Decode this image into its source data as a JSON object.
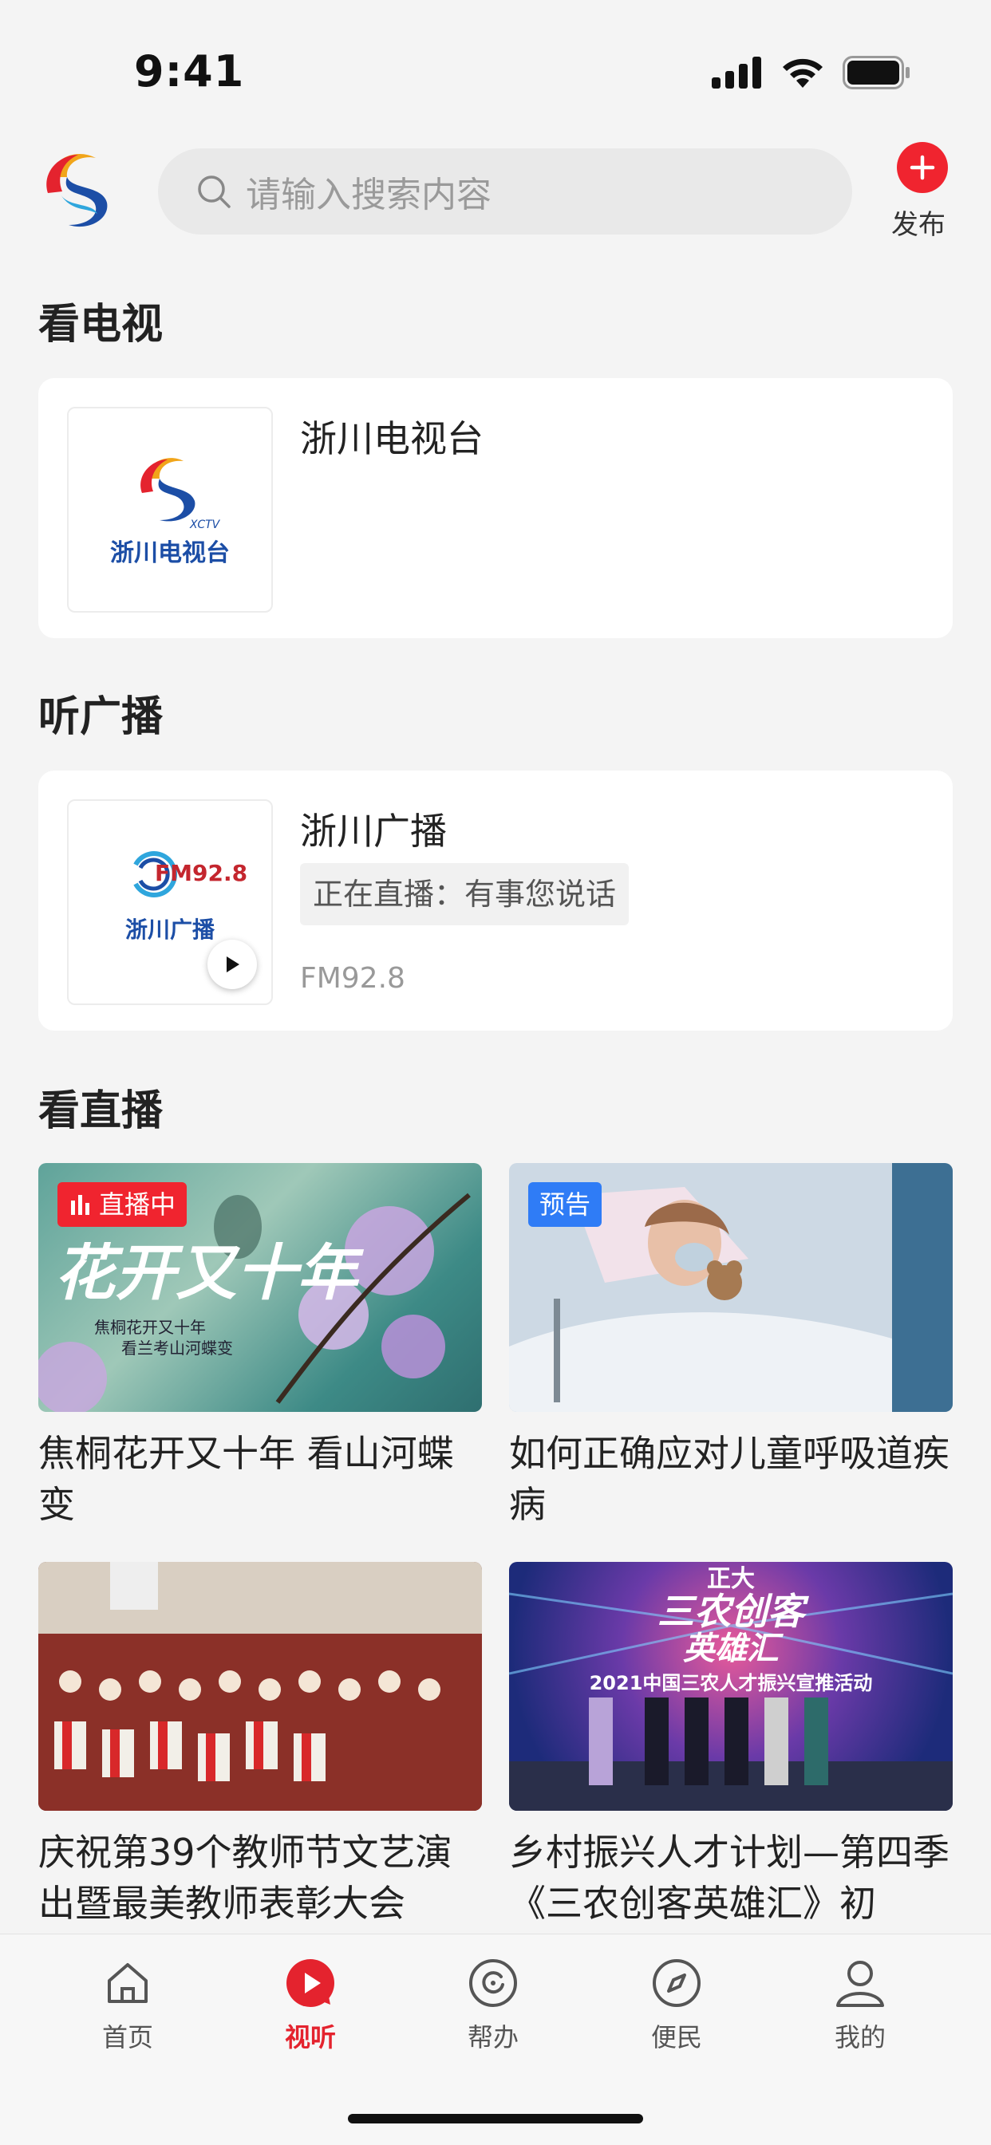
{
  "status": {
    "time": "9:41"
  },
  "search": {
    "placeholder": "请输入搜索内容"
  },
  "publish": {
    "label": "发布"
  },
  "tv": {
    "title": "看电视",
    "station": {
      "name": "浙川电视台",
      "logo_text": "浙川电视台",
      "logo_sub": "XCTV"
    }
  },
  "radio": {
    "title": "听广播",
    "station": {
      "name": "浙川广播",
      "live": "正在直播：有事您说话",
      "freq": "FM92.8",
      "logo_freq": "FM92.8",
      "logo_text": "浙川广播"
    }
  },
  "live": {
    "title": "看直播",
    "items": [
      {
        "title": "焦桐花开又十年 看山河蝶变",
        "badge": "直播中",
        "badge_type": "live",
        "art_title": "花开又十年",
        "art_line1": "焦桐花开又十年",
        "art_line2": "看兰考山河蝶变"
      },
      {
        "title": "如何正确应对儿童呼吸道疾病",
        "badge": "预告",
        "badge_type": "preview"
      },
      {
        "title": "庆祝第39个教师节文艺演出暨最美教师表彰大会",
        "badge": "",
        "badge_type": ""
      },
      {
        "title": "乡村振兴人才计划—第四季《三农创客英雄汇》初",
        "badge": "",
        "badge_type": "",
        "art_top": "正大",
        "art_main": "三农创客",
        "art_main2": "英雄汇",
        "art_sub": "2021中国三农人才振兴宣推活动"
      }
    ]
  },
  "tabs": [
    {
      "label": "首页",
      "icon": "home-icon"
    },
    {
      "label": "视听",
      "icon": "play-icon",
      "active": true
    },
    {
      "label": "帮办",
      "icon": "help-icon"
    },
    {
      "label": "便民",
      "icon": "compass-icon"
    },
    {
      "label": "我的",
      "icon": "user-icon"
    }
  ],
  "colors": {
    "accent": "#e4232e",
    "live_badge": "#f0242f",
    "preview_badge": "#2f7cf6",
    "bg": "#f4f4f4"
  }
}
